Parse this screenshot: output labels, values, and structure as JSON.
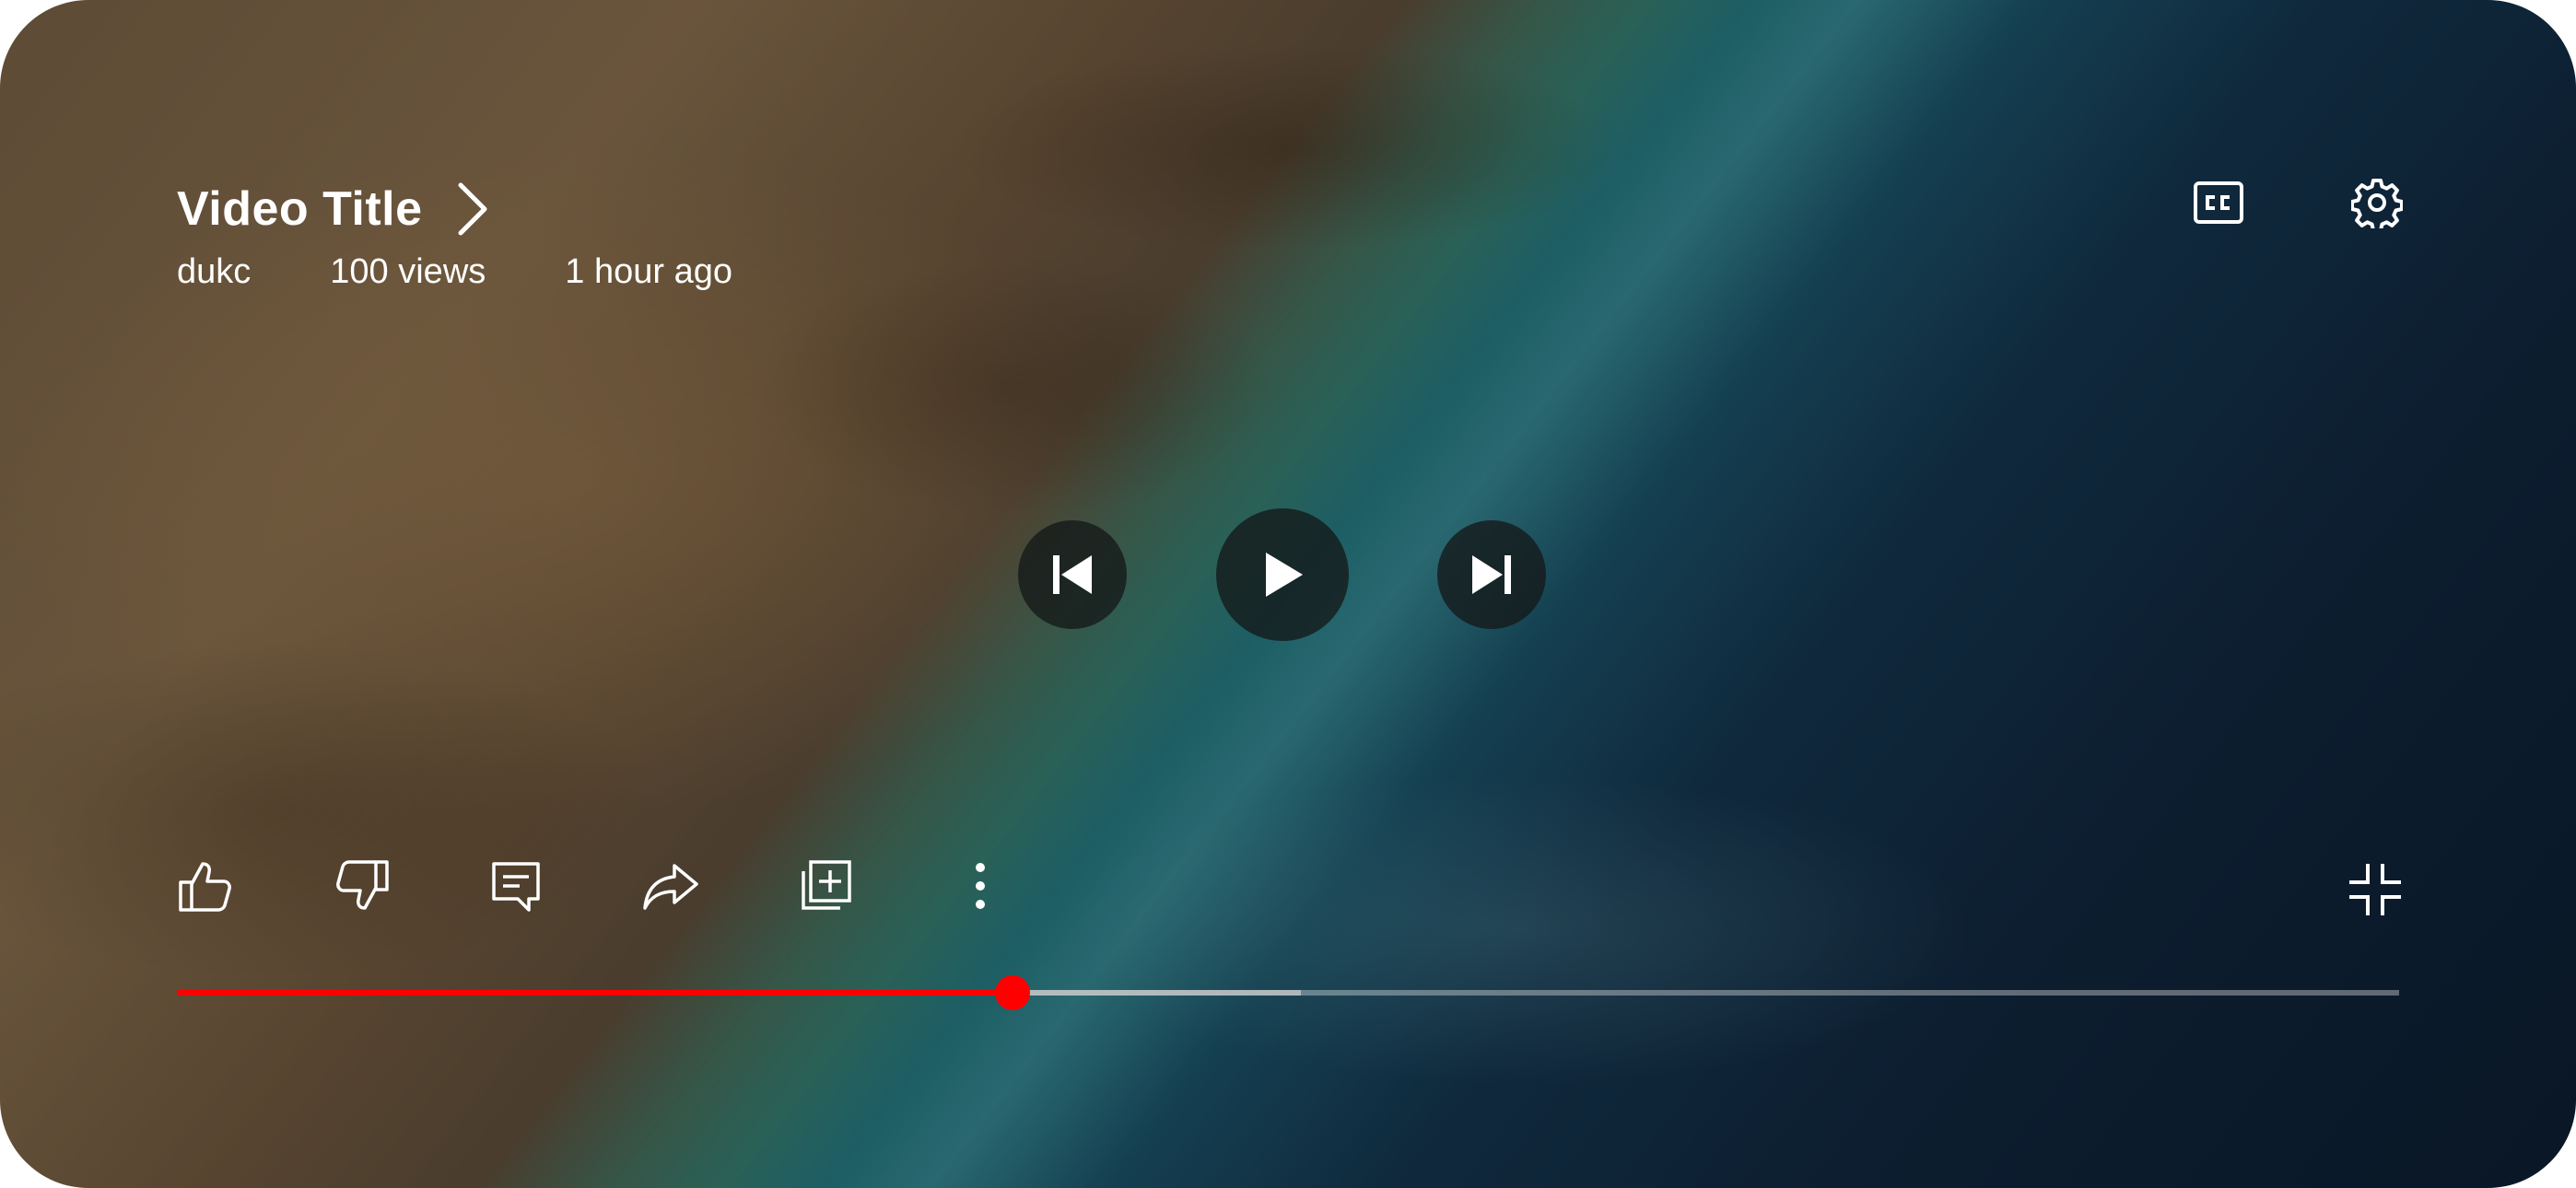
{
  "video": {
    "title": "Video Title",
    "channel": "dukc",
    "views": "100 views",
    "age": "1 hour ago"
  },
  "icons": {
    "title_chevron": "chevron-right-icon",
    "captions": "closed-captions-icon",
    "settings": "gear-icon",
    "previous": "skip-previous-icon",
    "play": "play-icon",
    "next": "skip-next-icon",
    "like": "thumbs-up-icon",
    "dislike": "thumbs-down-icon",
    "comments": "comment-icon",
    "share": "share-icon",
    "save": "add-to-playlist-icon",
    "more": "more-vert-icon",
    "exit_fullscreen": "exit-fullscreen-icon"
  },
  "progress": {
    "played_fraction": 0.376,
    "buffered_fraction": 0.506
  },
  "colors": {
    "progress_played": "#ff0000",
    "progress_thumb": "#ff0000",
    "icon": "#ffffff"
  }
}
